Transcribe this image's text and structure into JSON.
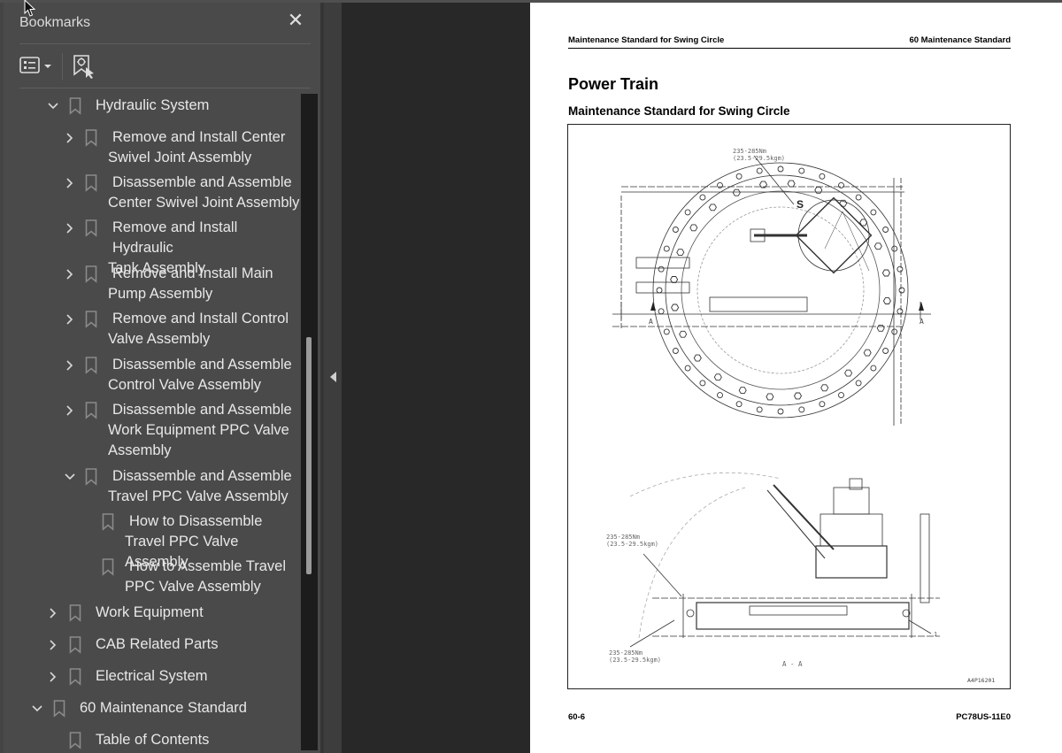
{
  "bookmarks_panel": {
    "title": "Bookmarks",
    "close_icon": "close-icon",
    "toolbar": {
      "options_icon": "list-options-icon",
      "find_current_icon": "find-current-bookmark-icon"
    },
    "items": [
      {
        "label": "Hydraulic System",
        "level": 1,
        "expander": "expanded"
      },
      {
        "label": "Remove and Install Center Swivel Joint Assembly",
        "level": 2,
        "expander": "collapsed",
        "line1": "Remove and Install Center",
        "line2": "Swivel Joint Assembly"
      },
      {
        "label": "Disassemble and Assemble Center Swivel Joint Assembly",
        "level": 2,
        "expander": "collapsed",
        "line1": "Disassemble and Assemble",
        "line2": "Center Swivel Joint Assembly"
      },
      {
        "label": "Remove and Install Hydraulic Tank Assembly",
        "level": 2,
        "expander": "collapsed",
        "line1": "Remove and Install Hydraulic",
        "line2": "Tank Assembly"
      },
      {
        "label": "Remove and Install Main Pump Assembly",
        "level": 2,
        "expander": "collapsed",
        "line1": "Remove and Install Main",
        "line2": "Pump Assembly"
      },
      {
        "label": "Remove and Install Control Valve Assembly",
        "level": 2,
        "expander": "collapsed",
        "line1": "Remove and Install Control",
        "line2": "Valve Assembly"
      },
      {
        "label": "Disassemble and Assemble Control Valve Assembly",
        "level": 2,
        "expander": "collapsed",
        "line1": "Disassemble and Assemble",
        "line2": "Control Valve Assembly"
      },
      {
        "label": "Disassemble and Assemble Work Equipment PPC Valve Assembly",
        "level": 2,
        "expander": "collapsed",
        "line1": "Disassemble and Assemble",
        "line2": "Work Equipment PPC Valve",
        "line3": "Assembly"
      },
      {
        "label": "Disassemble and Assemble Travel PPC Valve Assembly",
        "level": 2,
        "expander": "expanded",
        "line1": "Disassemble and Assemble",
        "line2": "Travel PPC Valve Assembly"
      },
      {
        "label": "How to Disassemble Travel PPC Valve Assembly",
        "level": 3,
        "expander": "none",
        "line1": "How to Disassemble",
        "line2": "Travel PPC Valve Assembly"
      },
      {
        "label": "How to Assemble Travel PPC Valve Assembly",
        "level": 3,
        "expander": "none",
        "line1": "How to Assemble Travel",
        "line2": "PPC Valve Assembly"
      },
      {
        "label": "Work Equipment",
        "level": 1,
        "expander": "collapsed"
      },
      {
        "label": "CAB Related Parts",
        "level": 1,
        "expander": "collapsed"
      },
      {
        "label": "Electrical System",
        "level": 1,
        "expander": "collapsed"
      },
      {
        "label": "60 Maintenance Standard",
        "level": 0,
        "expander": "expanded"
      },
      {
        "label": "Table of Contents",
        "level": 1,
        "expander": "none"
      }
    ],
    "collapse_panel_icon": "collapse-panel-arrow-icon"
  },
  "document_page": {
    "header_left": "Maintenance Standard for Swing Circle",
    "header_right": "60 Maintenance Standard",
    "title": "Power Train",
    "subtitle": "Maintenance Standard for Swing Circle",
    "figure": {
      "torque_top_line1": "235-285Nm",
      "torque_top_line2": "(23.5-29.5kgm)",
      "label_s": "S",
      "section_mark_left": "A",
      "section_mark_right": "A",
      "torque_mid_line1": "235-285Nm",
      "torque_mid_line2": "(23.5-29.5kgm)",
      "torque_bottom_line1": "235-285Nm",
      "torque_bottom_line2": "(23.5-29.5kgm)",
      "section_label": "A - A",
      "callout_1": "1",
      "figure_code": "A4P16201"
    },
    "footer_left": "60-6",
    "footer_right": "PC78US-11E0"
  }
}
